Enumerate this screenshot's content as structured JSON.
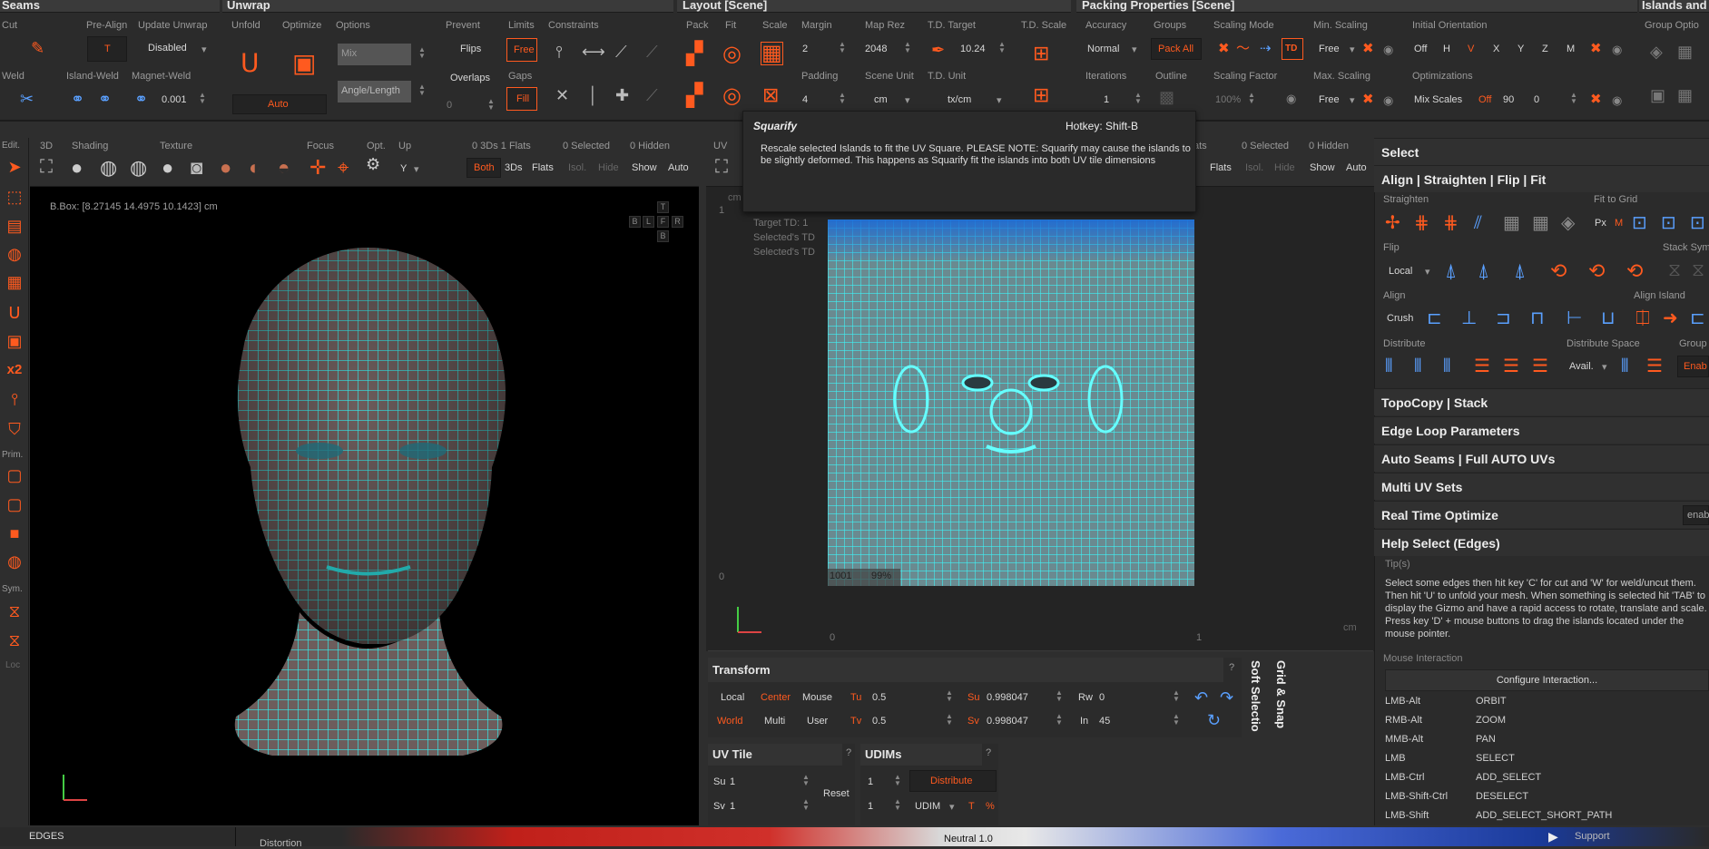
{
  "toolbar": {
    "seams": {
      "title": "Seams",
      "cut": "Cut",
      "weld": "Weld"
    },
    "unwrap": {
      "title": "Unwrap",
      "pre_align": "Pre-Align",
      "pre_align_value": "T",
      "update_unwrap": "Update Unwrap",
      "update_value": "Disabled",
      "island_weld": "Island-Weld",
      "magnet_weld": "Magnet-Weld",
      "magnet_value": "0.001",
      "unfold": "Unfold",
      "optimize": "Optimize",
      "options": "Options",
      "mix": "Mix",
      "angle_length": "Angle/Length",
      "auto": "Auto",
      "prevent": "Prevent",
      "flips": "Flips",
      "overlaps": "Overlaps",
      "overlaps_value": "0",
      "limits": "Limits",
      "free": "Free",
      "gaps": "Gaps",
      "fill": "Fill",
      "constraints": "Constraints"
    },
    "layout": {
      "title": "Layout [Scene]",
      "pack": "Pack",
      "fit": "Fit",
      "scale": "Scale",
      "margin": "Margin",
      "margin_value": "2",
      "padding": "Padding",
      "padding_value": "4",
      "map_rez": "Map Rez",
      "map_rez_value": "2048",
      "scene_unit": "Scene Unit",
      "scene_unit_value": "cm",
      "td_target": "T.D. Target",
      "td_target_value": "10.24",
      "td_unit": "T.D. Unit",
      "td_unit_value": "tx/cm",
      "td_scale": "T.D. Scale"
    },
    "packing": {
      "title": "Packing Properties [Scene]",
      "accuracy": "Accuracy",
      "accuracy_value": "Normal",
      "iterations": "Iterations",
      "iterations_value": "1",
      "groups": "Groups",
      "pack_all": "Pack All",
      "outline": "Outline",
      "scaling_mode": "Scaling Mode",
      "scaling_factor": "Scaling Factor",
      "scaling_factor_value": "100%",
      "td_badge": "TD",
      "min_scaling": "Min. Scaling",
      "min_value": "Free",
      "max_scaling": "Max. Scaling",
      "max_value": "Free",
      "initial_orientation": "Initial Orientation",
      "orient_off": "Off",
      "orient_h": "H",
      "orient_v": "V",
      "orient_x": "X",
      "orient_y": "Y",
      "orient_z": "Z",
      "orient_m": "M",
      "optimizations": "Optimizations",
      "mix_scales": "Mix Scales",
      "opt_off": "Off",
      "opt_90": "90",
      "opt_0": "0"
    },
    "islands": {
      "title": "Islands and",
      "group_options": "Group Optio"
    }
  },
  "viewport3d": {
    "header": {
      "edit": "Edit.",
      "three_d": "3D",
      "shading": "Shading",
      "texture": "Texture",
      "focus": "Focus",
      "opt": "Opt.",
      "up": "Up",
      "up_value": "Y",
      "counts": "0 3Ds 1 Flats",
      "selected": "0 Selected",
      "hidden": "0 Hidden",
      "both": "Both",
      "three_ds": "3Ds",
      "flats": "Flats",
      "isol": "Isol.",
      "hide": "Hide",
      "show": "Show",
      "auto": "Auto"
    },
    "bbox": "B.Box: [8.27145 14.4975 10.1423] cm",
    "cube": {
      "t": "T",
      "b": "B",
      "l": "L",
      "f": "F",
      "r": "R",
      "b2": "B"
    }
  },
  "left_tools": {
    "edit": "Edit.",
    "prim": "Prim.",
    "sym": "Sym.",
    "loc": "Loc",
    "x2": "x2"
  },
  "viewport_uv": {
    "label": "UV",
    "selected": "0 Selected",
    "hidden": "0 Hidden",
    "flats": "Flats",
    "isol": "Isol.",
    "hide": "Hide",
    "show": "Show",
    "auto": "Auto",
    "ats": "ats",
    "target_td": "Target TD: 1",
    "selected_td1": "Selected's TD",
    "selected_td2": "Selected's TD",
    "tile_label": "1001",
    "tile_pct": "99%",
    "axis_one_v": "1",
    "axis_zero_v": "0",
    "axis_zero_h": "0",
    "axis_one_h": "1",
    "unit": "cm",
    "cm_tl": "cm"
  },
  "tooltip": {
    "title": "Squarify",
    "hotkey": "Hotkey: Shift-B",
    "body": "Rescale selected Islands to fit the UV Square. PLEASE NOTE: Squarify may cause the islands to be slightly deformed. This happens as Squarify fit the islands into both UV tile dimensions"
  },
  "transform": {
    "title": "Transform",
    "local": "Local",
    "center": "Center",
    "mouse": "Mouse",
    "world": "World",
    "multi": "Multi",
    "user": "User",
    "tu": "Tu",
    "tu_value": "0.5",
    "tv": "Tv",
    "tv_value": "0.5",
    "su": "Su",
    "su_value": "0.998047",
    "sv": "Sv",
    "sv_value": "0.998047",
    "rw": "Rw",
    "rw_value": "0",
    "in": "In",
    "in_value": "45",
    "help": "?"
  },
  "side_tabs": {
    "soft_selection": "Soft Selectio",
    "grid_snap": "Grid & Snap"
  },
  "uv_tile": {
    "title": "UV Tile",
    "su": "Su",
    "su_value": "1",
    "sv": "Sv",
    "sv_value": "1",
    "reset": "Reset",
    "help": "?"
  },
  "udims": {
    "title": "UDIMs",
    "value1": "1",
    "value2": "1",
    "distribute": "Distribute",
    "udim": "UDIM",
    "t": "T",
    "pct": "%",
    "help": "?"
  },
  "right_panel": {
    "select": "Select",
    "align_title": "Align | Straighten | Flip | Fit",
    "straighten": "Straighten",
    "fit_to_grid": "Fit to Grid",
    "px": "Px",
    "m": "M",
    "flip": "Flip",
    "flip_local": "Local",
    "stack_sym": "Stack Sym",
    "align": "Align",
    "crush": "Crush",
    "align_island": "Align Island",
    "distribute": "Distribute",
    "distribute_space": "Distribute Space",
    "avail": "Avail.",
    "group": "Group",
    "enable": "Enab",
    "sections": [
      "TopoCopy | Stack",
      "Edge Loop Parameters",
      "Auto Seams | Full AUTO UVs",
      "Multi UV Sets",
      "Real Time Optimize",
      "Help Select (Edges)"
    ],
    "rto_value": "enab",
    "tips_label": "Tip(s)",
    "tips_text": "Select some edges then hit key 'C' for cut and 'W' for weld/uncut them. Then hit 'U' to unfold your mesh. When something is selected hit 'TAB' to display the Gizmo and have a rapid access to rotate, translate and scale. Press key 'D' + mouse buttons to drag the islands located under the mouse pointer.",
    "mouse_interaction": "Mouse Interaction",
    "configure": "Configure Interaction...",
    "keys": [
      [
        "LMB-Alt",
        "ORBIT"
      ],
      [
        "RMB-Alt",
        "ZOOM"
      ],
      [
        "MMB-Alt",
        "PAN"
      ],
      [
        "LMB",
        "SELECT"
      ],
      [
        "LMB-Ctrl",
        "ADD_SELECT"
      ],
      [
        "LMB-Shift-Ctrl",
        "DESELECT"
      ],
      [
        "LMB-Shift",
        "ADD_SELECT_SHORT_PATH"
      ]
    ]
  },
  "statusbar": {
    "mode": "EDGES",
    "distortion": "Distortion",
    "neutral": "Neutral 1.0",
    "support": "Support"
  }
}
